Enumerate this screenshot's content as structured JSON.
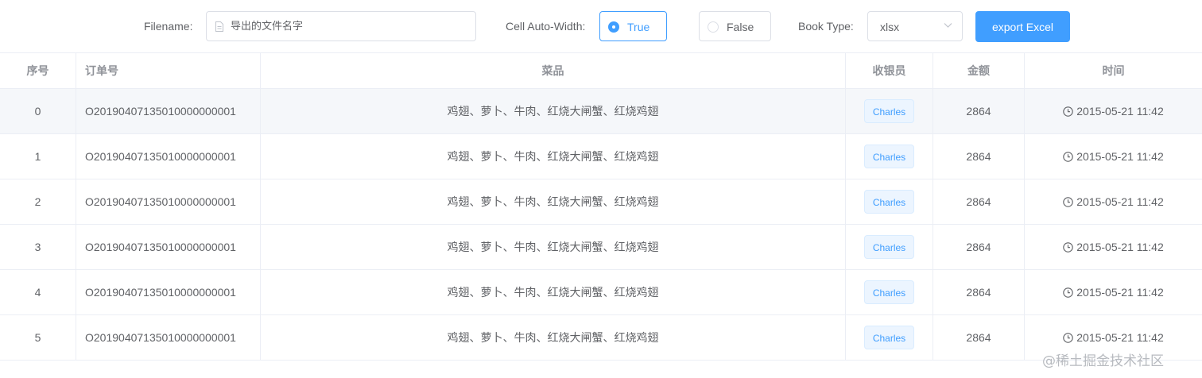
{
  "toolbar": {
    "filename_label": "Filename:",
    "filename_placeholder": "导出的文件名字",
    "auto_width_label": "Cell Auto-Width:",
    "auto_width_options": [
      {
        "label": "True",
        "checked": true
      },
      {
        "label": "False",
        "checked": false
      }
    ],
    "book_type_label": "Book Type:",
    "book_type_value": "xlsx",
    "export_label": "export Excel"
  },
  "table": {
    "columns": [
      "序号",
      "订单号",
      "菜品",
      "收银员",
      "金额",
      "时间"
    ],
    "rows": [
      {
        "index": "0",
        "order_no": "O2019040713501000000000​1",
        "dishes": "鸡翅、萝卜、牛肉、红烧大闸蟹、红烧鸡翅",
        "cashier": "Charles",
        "amount": "2864",
        "time": "2015-05-21 11:42"
      },
      {
        "index": "1",
        "order_no": "O2019040713501000000000​1",
        "dishes": "鸡翅、萝卜、牛肉、红烧大闸蟹、红烧鸡翅",
        "cashier": "Charles",
        "amount": "2864",
        "time": "2015-05-21 11:42"
      },
      {
        "index": "2",
        "order_no": "O2019040713501000000000​1",
        "dishes": "鸡翅、萝卜、牛肉、红烧大闸蟹、红烧鸡翅",
        "cashier": "Charles",
        "amount": "2864",
        "time": "2015-05-21 11:42"
      },
      {
        "index": "3",
        "order_no": "O2019040713501000000000​1",
        "dishes": "鸡翅、萝卜、牛肉、红烧大闸蟹、红烧鸡翅",
        "cashier": "Charles",
        "amount": "2864",
        "time": "2015-05-21 11:42"
      },
      {
        "index": "4",
        "order_no": "O2019040713501000000000​1",
        "dishes": "鸡翅、萝卜、牛肉、红烧大闸蟹、红烧鸡翅",
        "cashier": "Charles",
        "amount": "2864",
        "time": "2015-05-21 11:42"
      },
      {
        "index": "5",
        "order_no": "O2019040713501000000000​1",
        "dishes": "鸡翅、萝卜、牛肉、红烧大闸蟹、红烧鸡翅",
        "cashier": "Charles",
        "amount": "2864",
        "time": "2015-05-21 11:42"
      }
    ]
  },
  "watermark": "@稀土掘金技术社区",
  "colors": {
    "primary": "#409eff",
    "border": "#dcdfe6",
    "stripe": "#f5f7fa",
    "tag_bg": "#ecf5ff"
  },
  "icons": {
    "filename_input": "document-icon",
    "select": "chevron-down-icon",
    "time": "clock-icon"
  }
}
